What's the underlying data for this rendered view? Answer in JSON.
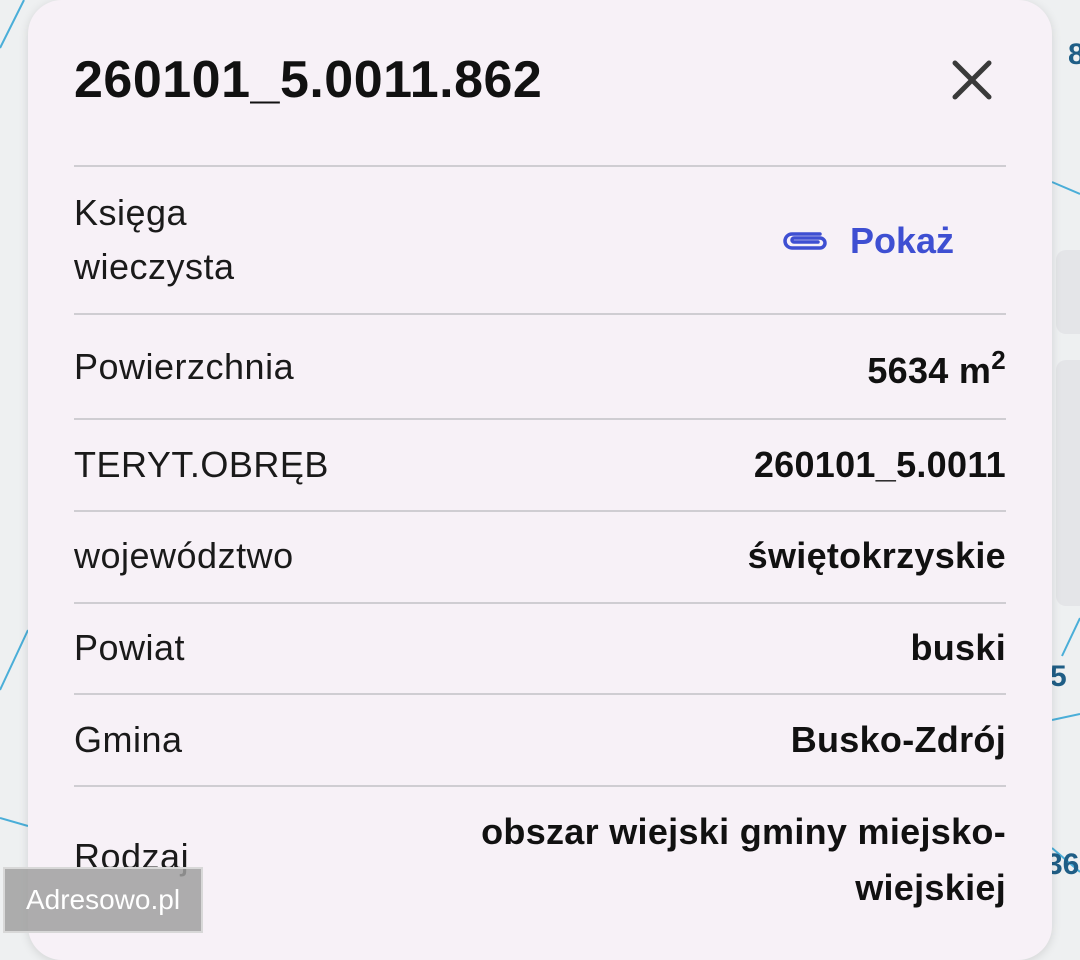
{
  "map": {
    "edge_labels": [
      "8",
      "5",
      "36"
    ]
  },
  "parcel": {
    "title": "260101_5.0011.862",
    "close_icon": "close-icon",
    "rows": {
      "ksiega": {
        "label_line1": "Księga",
        "label_line2": "wieczysta",
        "link_label": "Pokaż",
        "link_icon": "paperclip-icon"
      },
      "powierzchnia": {
        "label": "Powierzchnia",
        "value": "5634 m",
        "unit_exponent": "2"
      },
      "teryt": {
        "label": "TERYT.OBRĘB",
        "value": "260101_5.0011"
      },
      "wojewodztwo": {
        "label": "województwo",
        "value": "świętokrzyskie"
      },
      "powiat": {
        "label": "Powiat",
        "value": "buski"
      },
      "gmina": {
        "label": "Gmina",
        "value": "Busko-Zdrój"
      },
      "rodzaj": {
        "label": "Rodzaj",
        "value_line1": "obszar wiejski gminy miejsko-",
        "value_line2": "wiejskiej"
      }
    }
  },
  "watermark": {
    "text": "Adresowo.pl"
  },
  "colors": {
    "sheet": "#f7f1f7",
    "link": "#3e4fd2",
    "map_lines": "#4aaed8"
  }
}
